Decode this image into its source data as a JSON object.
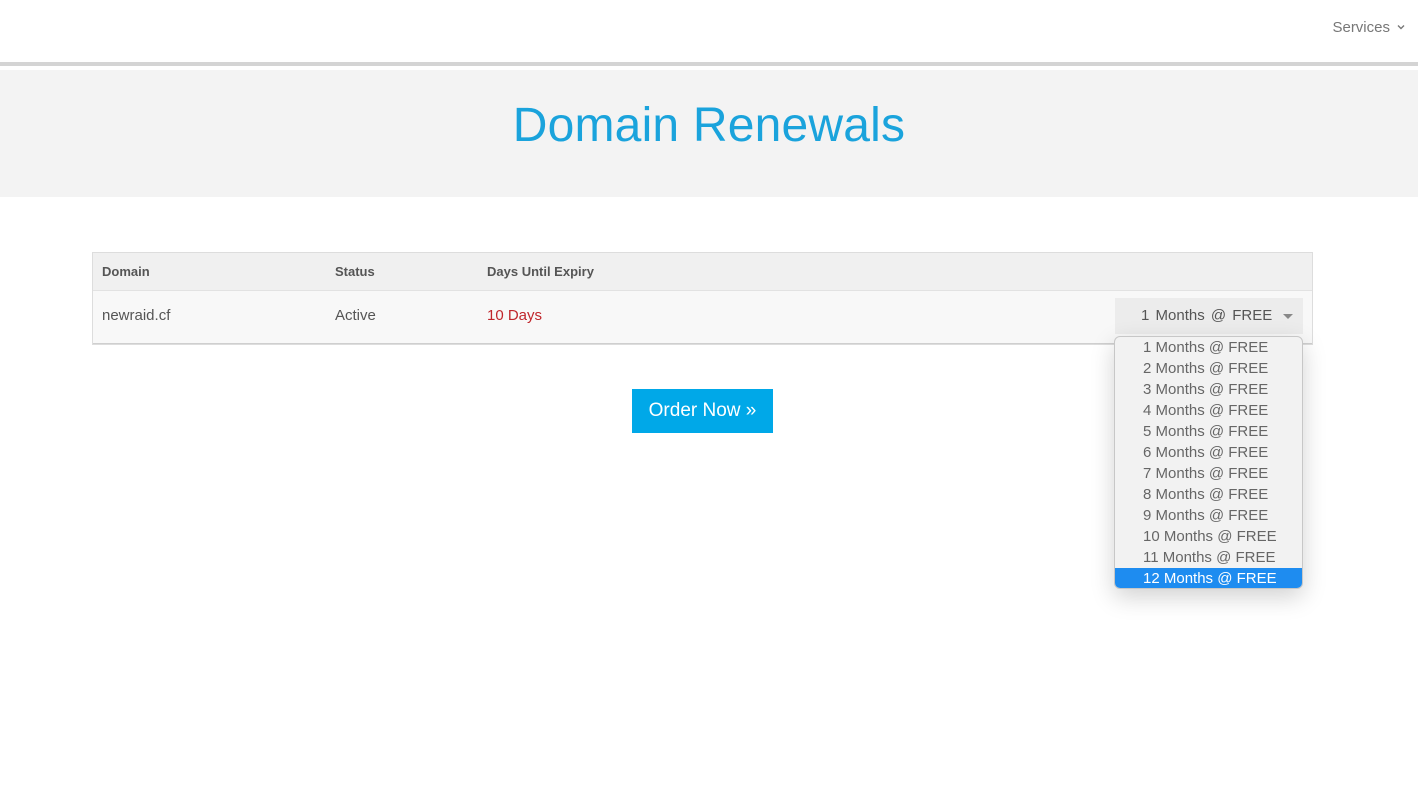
{
  "nav": {
    "services_label": "Services"
  },
  "page": {
    "title": "Domain Renewals"
  },
  "table": {
    "headers": {
      "domain": "Domain",
      "status": "Status",
      "days": "Days Until Expiry"
    },
    "rows": [
      {
        "domain": "newraid.cf",
        "status": "Active",
        "days": "10 Days",
        "period_selected": "1 Months @ FREE"
      }
    ]
  },
  "dropdown": {
    "options": [
      "1 Months @ FREE",
      "2 Months @ FREE",
      "3 Months @ FREE",
      "4 Months @ FREE",
      "5 Months @ FREE",
      "6 Months @ FREE",
      "7 Months @ FREE",
      "8 Months @ FREE",
      "9 Months @ FREE",
      "10 Months @ FREE",
      "11 Months @ FREE",
      "12 Months @ FREE"
    ],
    "highlighted": "12 Months @ FREE"
  },
  "actions": {
    "order_label": "Order Now »"
  },
  "colors": {
    "accent": "#00a8e8",
    "title": "#1aa3dc",
    "expiry": "#c0262c",
    "highlight": "#1e8cf0"
  },
  "icons": {
    "services_chevron": "chevron-down-icon",
    "select_caret": "caret-down-icon"
  }
}
